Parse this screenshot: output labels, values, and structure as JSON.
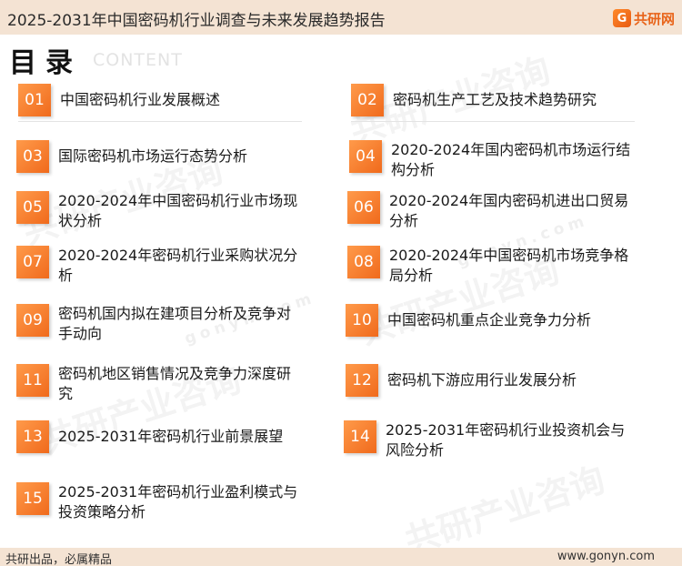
{
  "header": {
    "title": "2025-2031年中国密码机行业调查与未来发展趋势报告",
    "brand_mark": "G",
    "brand_name": "共研网"
  },
  "section": {
    "title": "目录",
    "subtitle": "CONTENT"
  },
  "watermark": {
    "text": "共研产业咨询",
    "url": "gonyn.com"
  },
  "toc": [
    {
      "num": "01",
      "text": "中国密码机行业发展概述"
    },
    {
      "num": "02",
      "text": "密码机生产工艺及技术趋势研究"
    },
    {
      "num": "03",
      "text": "国际密码机市场运行态势分析"
    },
    {
      "num": "04",
      "text": "2020-2024年国内密码机市场运行结构分析"
    },
    {
      "num": "05",
      "text": "2020-2024年中国密码机行业市场现状分析"
    },
    {
      "num": "06",
      "text": "2020-2024年国内密码机进出口贸易分析"
    },
    {
      "num": "07",
      "text": "2020-2024年密码机行业采购状况分析"
    },
    {
      "num": "08",
      "text": "2020-2024年中国密码机市场竞争格局分析"
    },
    {
      "num": "09",
      "text": "密码机国内拟在建项目分析及竞争对手动向"
    },
    {
      "num": "10",
      "text": "中国密码机重点企业竞争力分析"
    },
    {
      "num": "11",
      "text": "密码机地区销售情况及竞争力深度研究"
    },
    {
      "num": "12",
      "text": "密码机下游应用行业发展分析"
    },
    {
      "num": "13",
      "text": "2025-2031年密码机行业前景展望"
    },
    {
      "num": "14",
      "text": "2025-2031年密码机行业投资机会与风险分析"
    },
    {
      "num": "15",
      "text": "2025-2031年密码机行业盈利模式与投资策略分析"
    }
  ],
  "footer": {
    "left": "共研出品，必属精品",
    "right": "www.gonyn.com"
  }
}
